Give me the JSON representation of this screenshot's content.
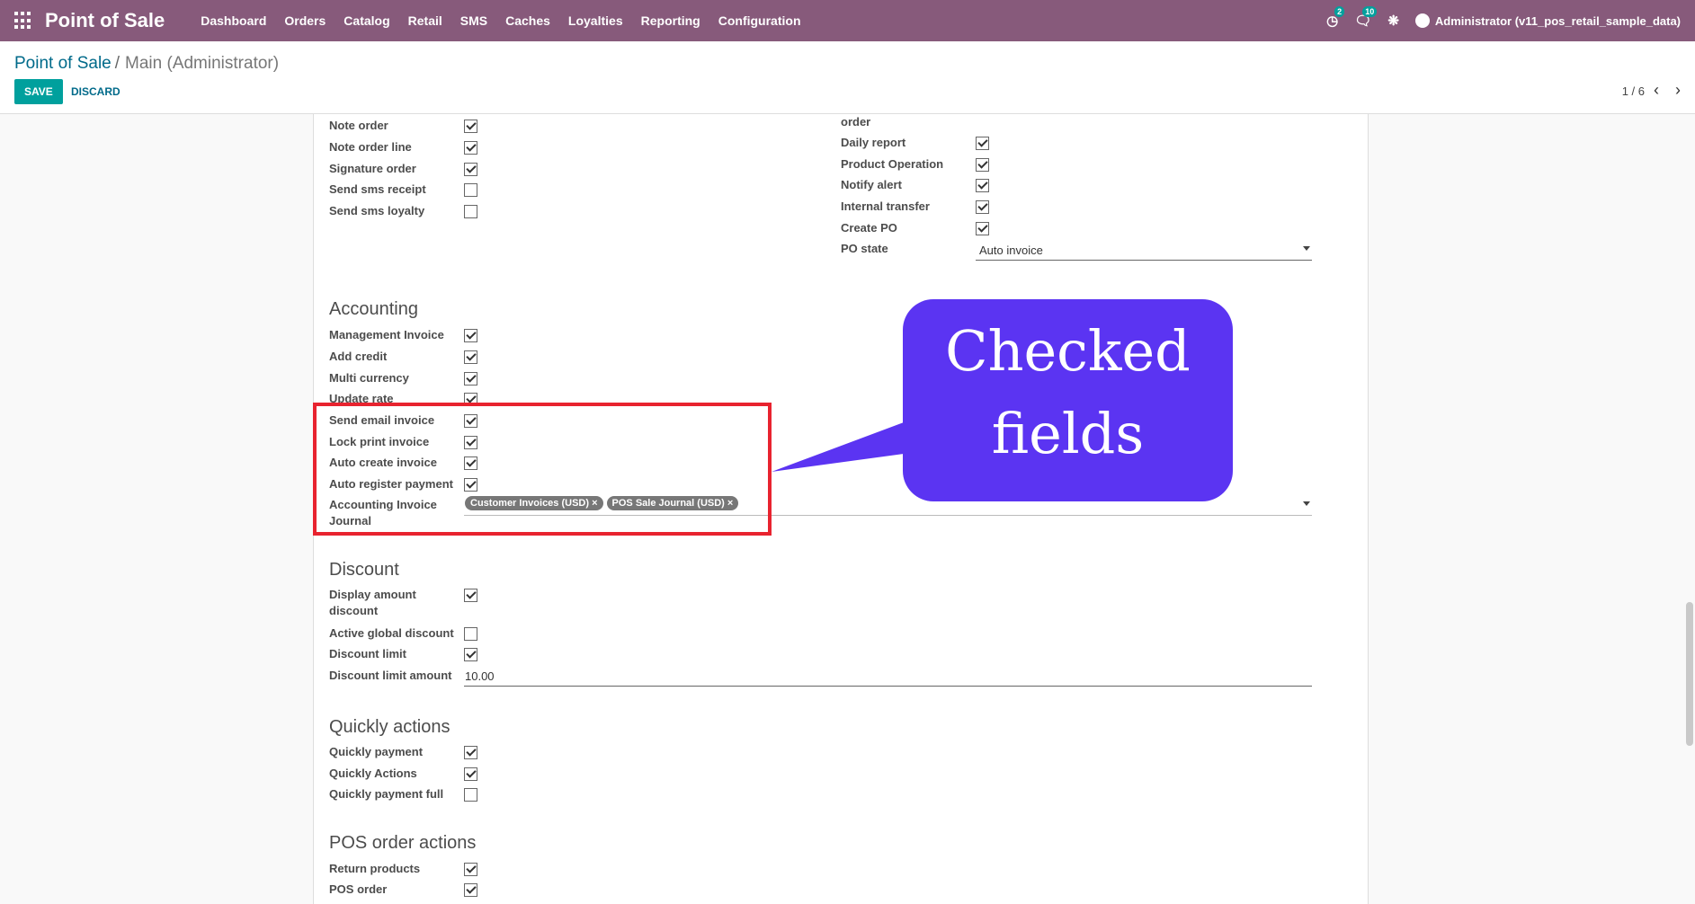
{
  "navbar": {
    "brand": "Point of Sale",
    "menu": [
      "Dashboard",
      "Orders",
      "Catalog",
      "Retail",
      "SMS",
      "Caches",
      "Loyalties",
      "Reporting",
      "Configuration"
    ],
    "badges": {
      "activity": "2",
      "messages": "10"
    },
    "user": "Administrator (v11_pos_retail_sample_data)"
  },
  "control": {
    "breadcrumb_root": "Point of Sale",
    "breadcrumb_sep": "/",
    "breadcrumb_current": "Main (Administrator)",
    "save": "SAVE",
    "discard": "DISCARD",
    "pager": "1 / 6"
  },
  "left_top": [
    {
      "label": "Note order",
      "checked": true
    },
    {
      "label": "Note order line",
      "checked": true
    },
    {
      "label": "Signature order",
      "checked": true
    },
    {
      "label": "Send sms receipt",
      "checked": false
    },
    {
      "label": "Send sms loyalty",
      "checked": false
    }
  ],
  "right_top": {
    "cut_label": "order",
    "items": [
      {
        "label": "Daily report",
        "checked": true
      },
      {
        "label": "Product Operation",
        "checked": true
      },
      {
        "label": "Notify alert",
        "checked": true
      },
      {
        "label": "Internal transfer",
        "checked": true
      },
      {
        "label": "Create PO",
        "checked": true
      }
    ],
    "po_state_label": "PO state",
    "po_state_value": "Auto invoice"
  },
  "accounting": {
    "title": "Accounting",
    "items": [
      {
        "label": "Management Invoice",
        "checked": true
      },
      {
        "label": "Add credit",
        "checked": true
      },
      {
        "label": "Multi currency",
        "checked": true
      },
      {
        "label": "Update rate",
        "checked": true
      },
      {
        "label": "Send email invoice",
        "checked": true
      },
      {
        "label": "Lock print invoice",
        "checked": true
      },
      {
        "label": "Auto create invoice",
        "checked": true
      },
      {
        "label": "Auto register payment",
        "checked": true
      }
    ],
    "journal_label": "Accounting Invoice Journal",
    "journal_tags": [
      "Customer Invoices (USD)",
      "POS Sale Journal (USD)"
    ],
    "tag_remove": "×"
  },
  "discount": {
    "title": "Discount",
    "items": [
      {
        "label": "Display amount discount",
        "checked": true
      },
      {
        "label": "Active global discount",
        "checked": false
      },
      {
        "label": "Discount limit",
        "checked": true
      }
    ],
    "limit_amount_label": "Discount limit amount",
    "limit_amount_value": "10.00"
  },
  "quickly": {
    "title": "Quickly actions",
    "items": [
      {
        "label": "Quickly payment",
        "checked": true
      },
      {
        "label": "Quickly Actions",
        "checked": true
      },
      {
        "label": "Quickly payment full",
        "checked": false
      }
    ]
  },
  "pos_order": {
    "title": "POS order actions",
    "items": [
      {
        "label": "Return products",
        "checked": true
      },
      {
        "label": "POS order",
        "checked": true
      }
    ]
  },
  "callout": {
    "line1": "Checked",
    "line2": "fields"
  },
  "colors": {
    "navbar": "#875a7b",
    "accent": "#00a09d",
    "highlight": "#e8232f",
    "callout": "#5b34f2"
  }
}
